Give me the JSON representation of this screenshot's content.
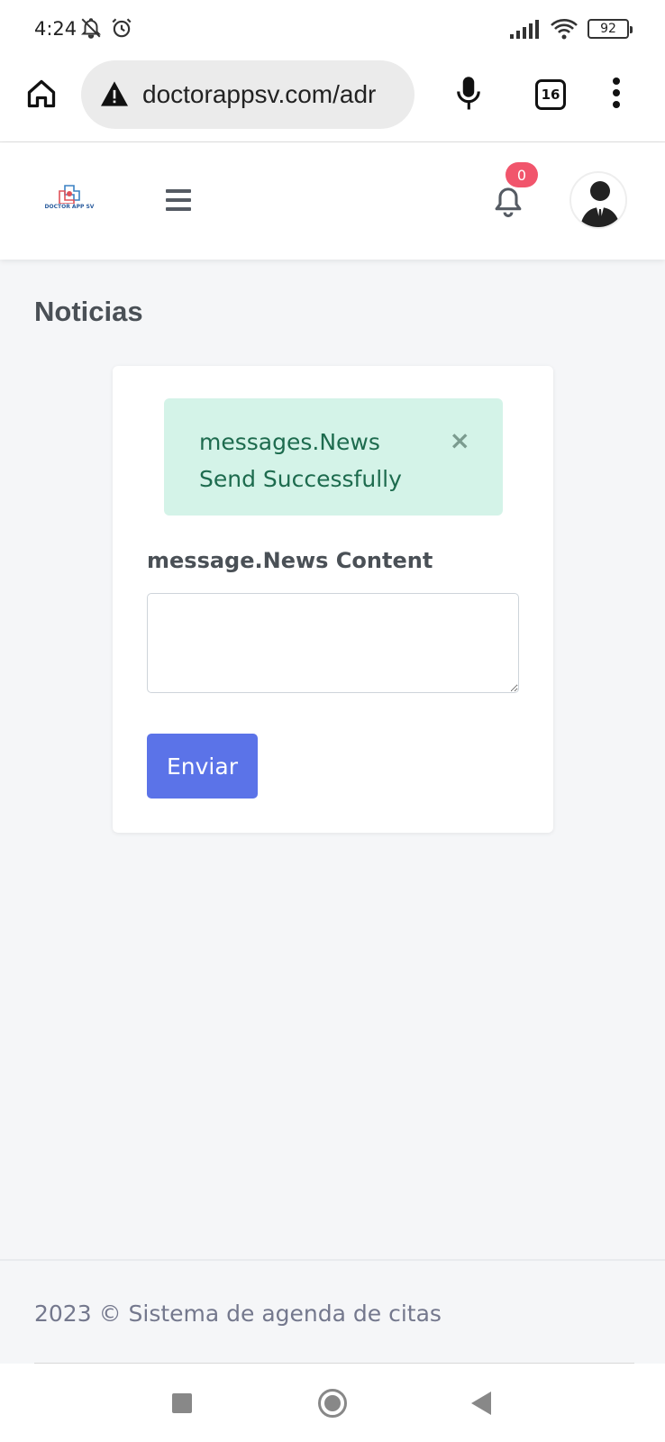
{
  "status_bar": {
    "time": "4:24",
    "battery": "92",
    "icons": [
      "notifications-off-icon",
      "alarm-icon",
      "signal-icon",
      "wifi-icon",
      "battery-icon"
    ]
  },
  "browser": {
    "url": "doctorappsv.com/adr",
    "tab_count": "16",
    "icons": [
      "home-icon",
      "warning-icon",
      "mic-icon",
      "tabs-icon",
      "more-vert-icon"
    ]
  },
  "header": {
    "logo_text": "DOCTOR APP SV",
    "notification_count": "0",
    "icons": [
      "menu-icon",
      "bell-icon",
      "user-avatar"
    ]
  },
  "page": {
    "title": "Noticias"
  },
  "alert": {
    "message": "messages.News Send Successfully",
    "close_label": "×"
  },
  "form": {
    "label": "message.News Content",
    "textarea_value": "",
    "submit_label": "Enviar"
  },
  "footer": {
    "text": "2023 © Sistema de agenda de citas"
  },
  "colors": {
    "primary": "#5b73e8",
    "alert_bg": "#d4f3e8",
    "alert_text": "#1d6b4e",
    "badge": "#f1556c",
    "page_bg": "#f5f6f8"
  }
}
